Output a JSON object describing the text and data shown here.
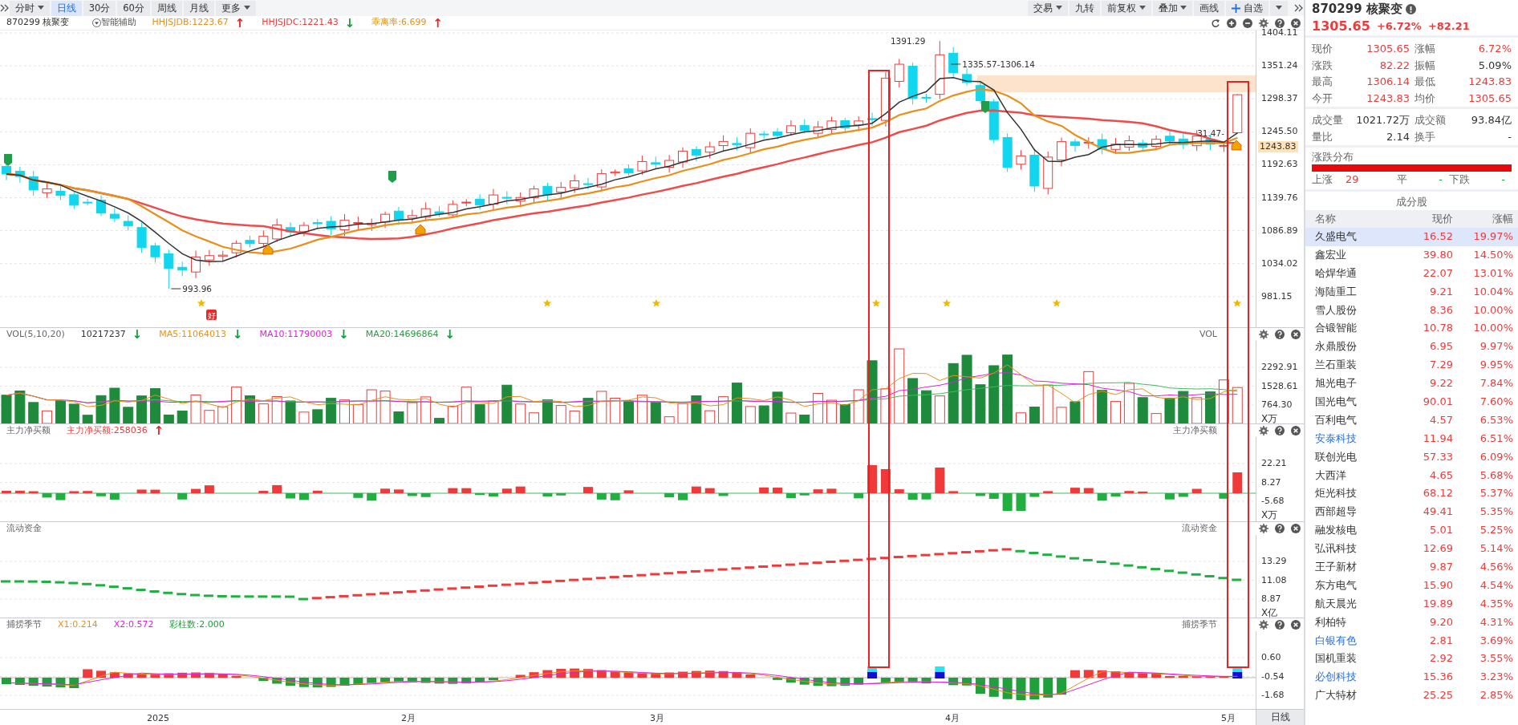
{
  "toolbar": {
    "left": [
      {
        "label": "分时",
        "dropdown": true,
        "selected": false
      },
      {
        "label": "日线",
        "dropdown": false,
        "selected": true
      },
      {
        "label": "30分",
        "dropdown": false,
        "selected": false
      },
      {
        "label": "60分",
        "dropdown": false,
        "selected": false
      },
      {
        "label": "周线",
        "dropdown": false,
        "selected": false
      },
      {
        "label": "月线",
        "dropdown": false,
        "selected": false
      },
      {
        "label": "更多",
        "dropdown": true,
        "selected": false
      }
    ],
    "right": [
      {
        "label": "交易",
        "kind": "menu"
      },
      {
        "label": "九转",
        "kind": "button"
      },
      {
        "label": "前复权",
        "kind": "menu"
      },
      {
        "label": "叠加",
        "kind": "menu"
      },
      {
        "label": "画线",
        "kind": "button"
      },
      {
        "label": "自选",
        "kind": "add"
      }
    ]
  },
  "chart_header": {
    "symbol": "870299 核聚变",
    "assist": "智能辅助",
    "indicators": [
      {
        "text": "HHJSJDB:1223.67",
        "color": "#e8901a",
        "arrow": {
          "text": "↑",
          "color": "#f02020"
        }
      },
      {
        "text": "HHJSJDC:1221.43",
        "color": "#f03a3a",
        "arrow": {
          "text": "↓",
          "color": "#12a03a"
        }
      },
      {
        "text": "乖离率:6.699",
        "color": "#e8901a",
        "arrow": {
          "text": "↑",
          "color": "#f02020"
        }
      }
    ]
  },
  "main_chart": {
    "price_labels": [
      "993.96",
      "1391.29",
      "1335.57-1306.14",
      "31.47-"
    ],
    "signal_tag": "好",
    "ticks": [
      "1404.11",
      "1351.24",
      "1298.37",
      "1245.50",
      "1192.63",
      "1139.76",
      "1086.89",
      "1034.02",
      "981.15"
    ],
    "current": "1243.83"
  },
  "panels": [
    {
      "kind": "volume",
      "name": "VOL",
      "title": "VOL(5,10,20)",
      "legend": [
        {
          "text": "10217237",
          "color": "#333333",
          "arrow": {
            "text": "↓",
            "color": "#12a03a"
          }
        },
        {
          "text": "MA5:11064013",
          "color": "#e8901a",
          "arrow": {
            "text": "↓",
            "color": "#12a03a"
          }
        },
        {
          "text": "MA10:11790003",
          "color": "#e020e0",
          "arrow": {
            "text": "↓",
            "color": "#12a03a"
          }
        },
        {
          "text": "MA20:14696864",
          "color": "#1fa03a",
          "arrow": {
            "text": "↓",
            "color": "#12a03a"
          }
        }
      ],
      "ticks": [
        "2292.91",
        "1528.61",
        "764.30"
      ],
      "unit": "X万"
    },
    {
      "kind": "netbuy",
      "name": "主力净买额",
      "title": "主力净买额",
      "legend": [
        {
          "text": "主力净买额:258036",
          "color": "#f03a3a",
          "arrow": {
            "text": "↑",
            "color": "#f02020"
          }
        }
      ],
      "ticks": [
        "22.21",
        "8.27",
        "-5.68"
      ],
      "unit": "X万"
    },
    {
      "kind": "flow",
      "name": "流动资金",
      "title": "流动资金",
      "ticks": [
        "13.29",
        "11.08",
        "8.87"
      ],
      "unit": "X亿"
    },
    {
      "kind": "season",
      "name": "捕捞季节",
      "title": "捕捞季节",
      "legend": [
        {
          "text": "X1:0.214",
          "color": "#e8901a"
        },
        {
          "text": "X2:0.572",
          "color": "#e020e0"
        },
        {
          "text": "彩柱数:2.000",
          "color": "#1fa03a"
        }
      ],
      "ticks": [
        "0.60",
        "-0.54",
        "-1.68"
      ]
    }
  ],
  "date_axis": {
    "labels": [
      "2025",
      "2月",
      "3月",
      "4月",
      "5月"
    ],
    "period": "日线"
  },
  "quote": {
    "symbol": "870299 核聚变",
    "price": "1305.65",
    "change_pct": "+6.72%",
    "change": "+82.21",
    "stats": [
      {
        "label": "现价",
        "value": "1305.65",
        "color": "#f03a3a"
      },
      {
        "label": "涨幅",
        "value": "6.72%",
        "color": "#f03a3a"
      },
      {
        "label": "涨跌",
        "value": "82.22",
        "color": "#f03a3a"
      },
      {
        "label": "振幅",
        "value": "5.09%",
        "color": "#333333"
      },
      {
        "label": "最高",
        "value": "1306.14",
        "color": "#f03a3a"
      },
      {
        "label": "最低",
        "value": "1243.83",
        "color": "#f03a3a"
      },
      {
        "label": "今开",
        "value": "1243.83",
        "color": "#f03a3a"
      },
      {
        "label": "均价",
        "value": "1305.65",
        "color": "#f03a3a"
      }
    ],
    "stats2": [
      {
        "label": "成交量",
        "value": "1021.72万",
        "color": "#333333"
      },
      {
        "label": "成交额",
        "value": "93.84亿",
        "color": "#333333"
      },
      {
        "label": "量比",
        "value": "2.14",
        "color": "#333333"
      },
      {
        "label": "换手",
        "value": "-",
        "color": "#333333"
      }
    ]
  },
  "distribution": {
    "title": "涨跌分布",
    "level": 1,
    "items": [
      {
        "label": "上涨",
        "value": "29",
        "color": "#f03a3a"
      },
      {
        "label": "平",
        "value": "-",
        "color": "#1fa03a"
      },
      {
        "label": "下跌",
        "value": "-",
        "color": "#1fa03a"
      }
    ]
  },
  "constituents": {
    "title": "成分股",
    "columns": [
      "名称",
      "现价",
      "涨幅"
    ],
    "rows": [
      {
        "name": "久盛电气",
        "price": "16.52",
        "pct": "19.97%",
        "selected": true,
        "linked": false
      },
      {
        "name": "鑫宏业",
        "price": "39.80",
        "pct": "14.50%",
        "selected": false,
        "linked": false
      },
      {
        "name": "哈焊华通",
        "price": "22.07",
        "pct": "13.01%",
        "selected": false,
        "linked": false
      },
      {
        "name": "海陆重工",
        "price": "9.21",
        "pct": "10.04%",
        "selected": false,
        "linked": false
      },
      {
        "name": "雪人股份",
        "price": "8.36",
        "pct": "10.00%",
        "selected": false,
        "linked": false
      },
      {
        "name": "合锻智能",
        "price": "10.78",
        "pct": "10.00%",
        "selected": false,
        "linked": false
      },
      {
        "name": "永鼎股份",
        "price": "6.95",
        "pct": "9.97%",
        "selected": false,
        "linked": false
      },
      {
        "name": "兰石重装",
        "price": "7.29",
        "pct": "9.95%",
        "selected": false,
        "linked": false
      },
      {
        "name": "旭光电子",
        "price": "9.22",
        "pct": "7.84%",
        "selected": false,
        "linked": false
      },
      {
        "name": "国光电气",
        "price": "90.01",
        "pct": "7.60%",
        "selected": false,
        "linked": false
      },
      {
        "name": "百利电气",
        "price": "4.57",
        "pct": "6.53%",
        "selected": false,
        "linked": false
      },
      {
        "name": "安泰科技",
        "price": "11.94",
        "pct": "6.51%",
        "selected": false,
        "linked": true
      },
      {
        "name": "联创光电",
        "price": "57.33",
        "pct": "6.09%",
        "selected": false,
        "linked": false
      },
      {
        "name": "大西洋",
        "price": "4.65",
        "pct": "5.68%",
        "selected": false,
        "linked": false
      },
      {
        "name": "炬光科技",
        "price": "68.12",
        "pct": "5.37%",
        "selected": false,
        "linked": false
      },
      {
        "name": "西部超导",
        "price": "49.41",
        "pct": "5.35%",
        "selected": false,
        "linked": false
      },
      {
        "name": "融发核电",
        "price": "5.01",
        "pct": "5.25%",
        "selected": false,
        "linked": false
      },
      {
        "name": "弘讯科技",
        "price": "12.69",
        "pct": "5.14%",
        "selected": false,
        "linked": false
      },
      {
        "name": "王子新材",
        "price": "9.87",
        "pct": "4.56%",
        "selected": false,
        "linked": false
      },
      {
        "name": "东方电气",
        "price": "15.90",
        "pct": "4.54%",
        "selected": false,
        "linked": false
      },
      {
        "name": "航天晨光",
        "price": "19.89",
        "pct": "4.35%",
        "selected": false,
        "linked": false
      },
      {
        "name": "利柏特",
        "price": "9.20",
        "pct": "4.31%",
        "selected": false,
        "linked": false
      },
      {
        "name": "白银有色",
        "price": "2.81",
        "pct": "3.69%",
        "selected": false,
        "linked": true
      },
      {
        "name": "国机重装",
        "price": "2.92",
        "pct": "3.55%",
        "selected": false,
        "linked": false
      },
      {
        "name": "必创科技",
        "price": "15.36",
        "pct": "3.23%",
        "selected": false,
        "linked": true
      },
      {
        "name": "广大特材",
        "price": "25.25",
        "pct": "2.85%",
        "selected": false,
        "linked": false
      }
    ]
  }
}
